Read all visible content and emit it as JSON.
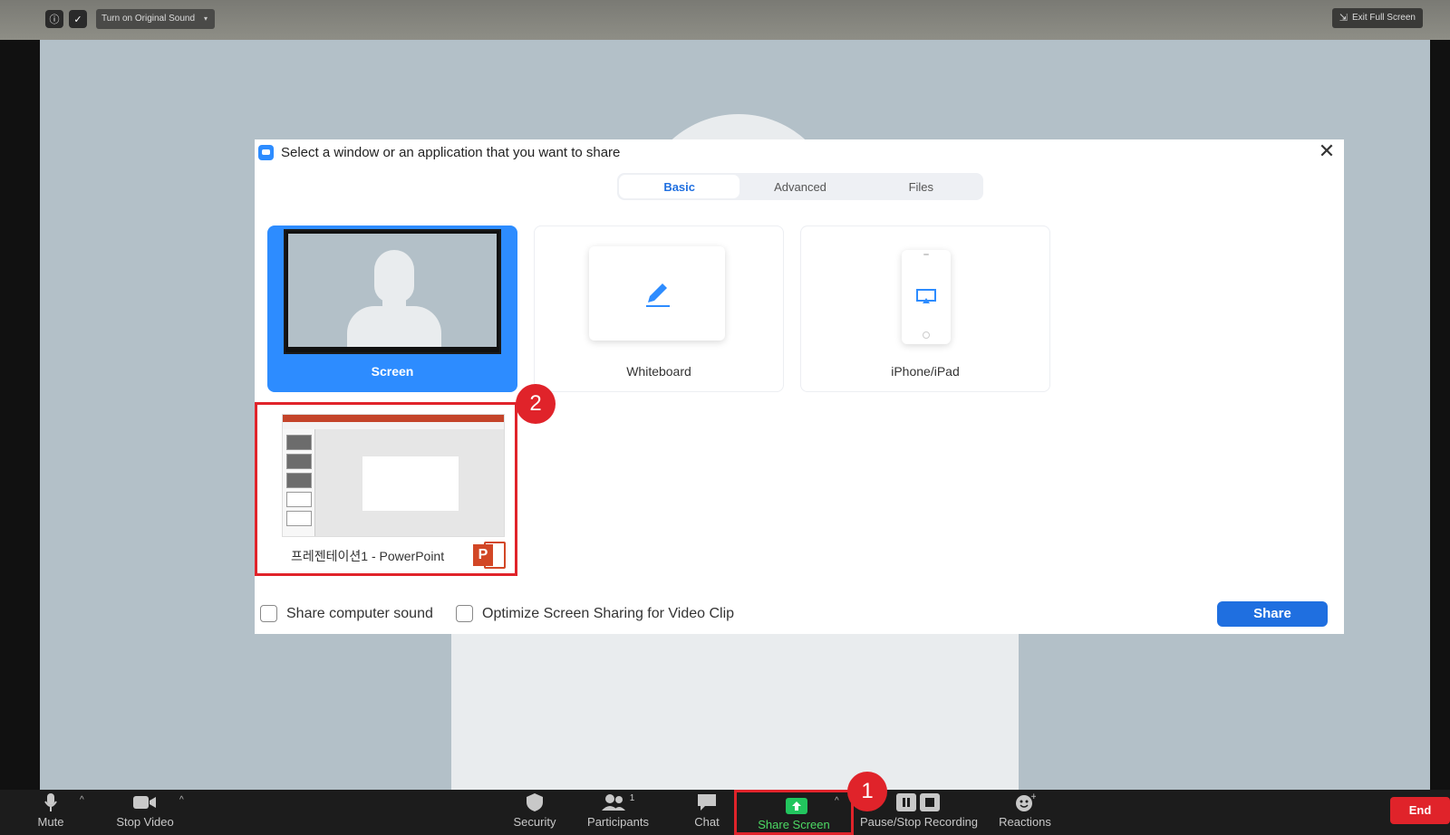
{
  "topbar": {
    "original_sound_label": "Turn on Original Sound",
    "exit_fullscreen_label": "Exit Full Screen"
  },
  "dialog": {
    "title": "Select a window or an application that you want to share",
    "close_glyph": "✕",
    "tabs": [
      {
        "label": "Basic",
        "active": true
      },
      {
        "label": "Advanced",
        "active": false
      },
      {
        "label": "Files",
        "active": false
      }
    ],
    "tiles": {
      "screen": "Screen",
      "whiteboard": "Whiteboard",
      "iphone": "iPhone/iPad",
      "powerpoint": "프레젠테이션1 - PowerPoint"
    },
    "options": {
      "share_sound": "Share computer sound",
      "optimize_video": "Optimize Screen Sharing for Video Clip"
    },
    "share_button": "Share"
  },
  "annotations": {
    "badge_1": "1",
    "badge_2": "2"
  },
  "toolbar": {
    "mute": "Mute",
    "stop_video": "Stop Video",
    "security": "Security",
    "participants": "Participants",
    "participants_count": "1",
    "chat": "Chat",
    "share_screen": "Share Screen",
    "recording": "Pause/Stop Recording",
    "reactions": "Reactions",
    "end": "End"
  },
  "colors": {
    "accent": "#2d8cff",
    "annotation_red": "#e0232a",
    "share_green": "#22c55e"
  }
}
